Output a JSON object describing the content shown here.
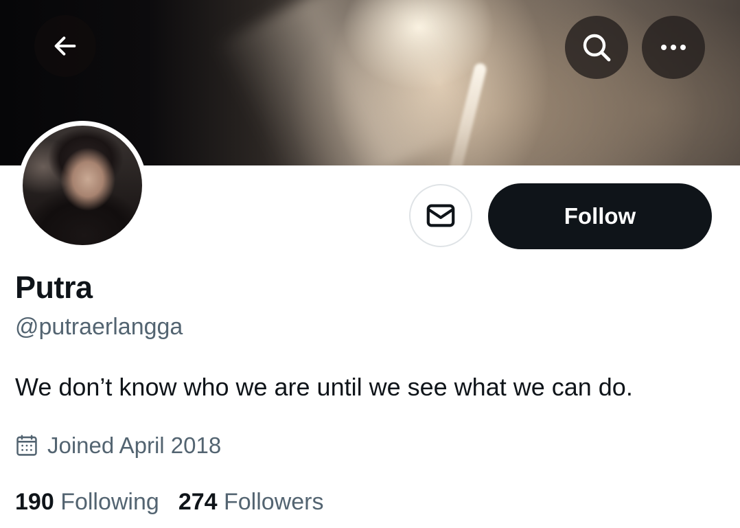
{
  "profile": {
    "name": "Putra",
    "handle": "@putraerlangga",
    "bio": "We don’t know who we are until we see what we can do.",
    "joined": "Joined April 2018"
  },
  "stats": {
    "following_count": "190",
    "following_label": "Following",
    "followers_count": "274",
    "followers_label": "Followers"
  },
  "actions": {
    "follow_label": "Follow"
  },
  "icons": {
    "back": "arrow-left-icon",
    "search": "search-icon",
    "more": "more-horizontal-icon",
    "message": "envelope-icon",
    "calendar": "calendar-icon"
  },
  "colors": {
    "primary_text": "#0f1419",
    "secondary_text": "#536471",
    "follow_button_bg": "#0f1419",
    "follow_button_text": "#ffffff",
    "border": "#dfe3e6"
  }
}
